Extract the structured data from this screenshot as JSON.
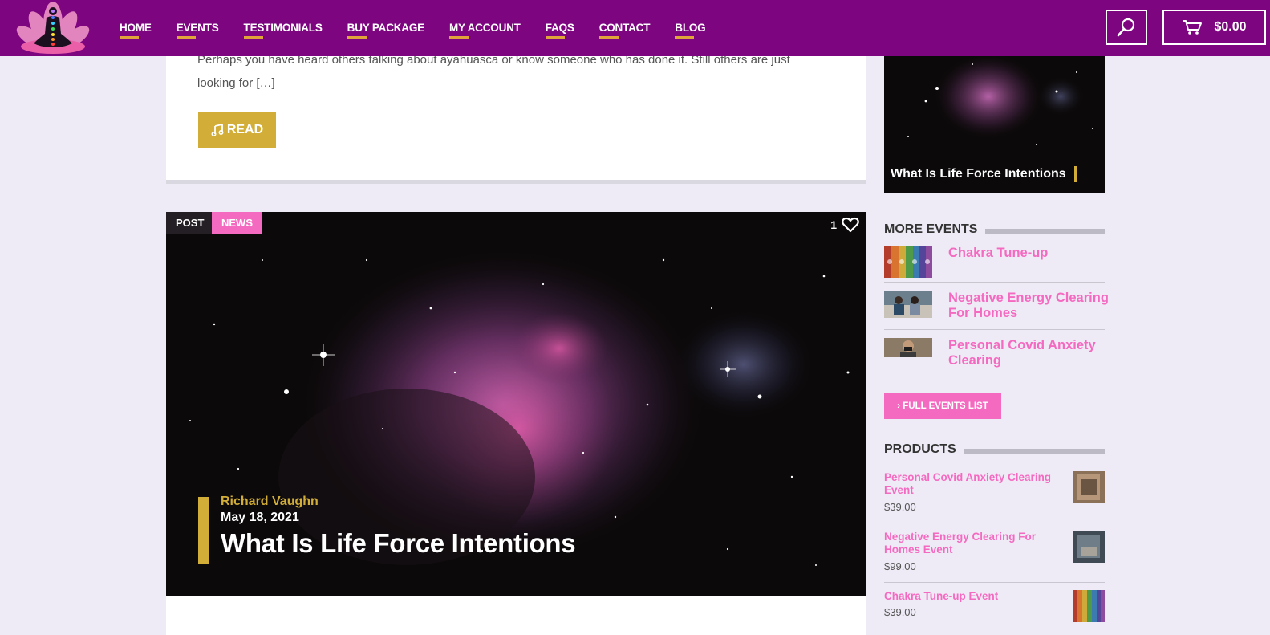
{
  "nav": {
    "items": [
      "HOME",
      "EVENTS",
      "TESTIMONIALS",
      "BUY PACKAGE",
      "MY ACCOUNT",
      "FAQS",
      "CONTACT",
      "BLOG"
    ],
    "cart_total": "$0.00"
  },
  "top_post": {
    "excerpt": "Perhaps you have heard others talking about ayahuasca or know someone who has done it. Still others are just looking for […]",
    "read_label": "READ"
  },
  "feature_post": {
    "tag_type": "POST",
    "tag_category": "NEWS",
    "likes": "1",
    "author": "Richard Vaughn",
    "date": "May 18, 2021",
    "title": "What Is Life Force Intentions"
  },
  "sidebar": {
    "featured_title": "What Is Life Force Intentions",
    "more_events": {
      "heading": "MORE EVENTS",
      "items": [
        {
          "title": "Chakra Tune-up"
        },
        {
          "title": "Negative Energy Clearing For Homes"
        },
        {
          "title": "Personal Covid Anxiety Clearing"
        }
      ],
      "button_label": "› FULL EVENTS LIST"
    },
    "products": {
      "heading": "PRODUCTS",
      "items": [
        {
          "name": "Personal Covid Anxiety Clearing Event",
          "price": "$39.00"
        },
        {
          "name": "Negative Energy Clearing For Homes Event",
          "price": "$99.00"
        },
        {
          "name": "Chakra Tune-up Event",
          "price": "$39.00"
        }
      ]
    }
  },
  "colors": {
    "header_bg": "#7d0680",
    "accent_gold": "#d2ad37",
    "accent_pink": "#f56ac1",
    "page_bg": "#eeebf6"
  }
}
